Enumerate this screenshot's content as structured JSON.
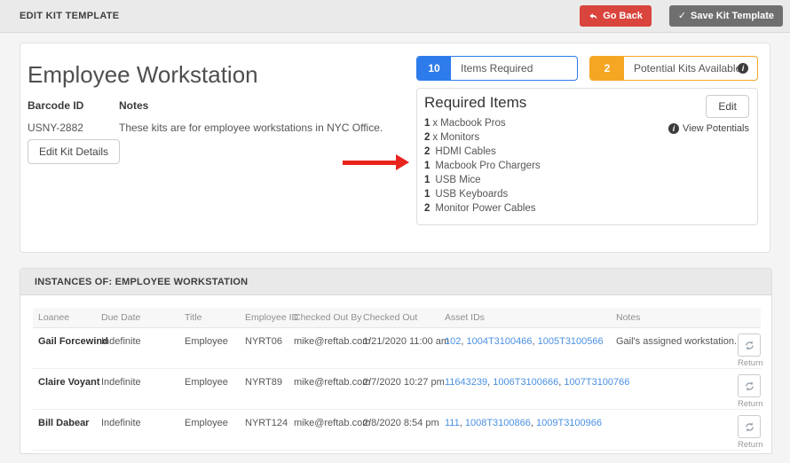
{
  "colors": {
    "accent_blue": "#2e7bec",
    "accent_orange": "#f5a623",
    "danger_red": "#d9443d",
    "button_gray": "#6f6f6f",
    "link_blue": "#4a90e2",
    "arrow_red": "#e8241d"
  },
  "header": {
    "title": "EDIT KIT TEMPLATE",
    "go_back_label": "Go Back",
    "save_label": "Save Kit Template"
  },
  "kit": {
    "title": "Employee Workstation",
    "barcode_label": "Barcode ID",
    "barcode_value": "USNY-2882",
    "notes_label": "Notes",
    "notes_value": "These kits are for employee workstations in NYC Office.",
    "edit_details_label": "Edit Kit Details"
  },
  "badges": {
    "items_required": {
      "count": "10",
      "label": "Items Required"
    },
    "potential_kits": {
      "count": "2",
      "label": "Potential Kits Available"
    }
  },
  "required_items": {
    "title": "Required Items",
    "edit_label": "Edit",
    "view_potentials_label": "View Potentials",
    "items": [
      {
        "qty": "1",
        "sep": "x",
        "name": "Macbook Pros"
      },
      {
        "qty": "2",
        "sep": "x",
        "name": "Monitors"
      },
      {
        "qty": "2",
        "sep": "",
        "name": "HDMI Cables"
      },
      {
        "qty": "1",
        "sep": "",
        "name": "Macbook Pro Chargers"
      },
      {
        "qty": "1",
        "sep": "",
        "name": "USB Mice"
      },
      {
        "qty": "1",
        "sep": "",
        "name": "USB Keyboards"
      },
      {
        "qty": "2",
        "sep": "",
        "name": "Monitor Power Cables"
      }
    ]
  },
  "instances": {
    "title": "INSTANCES OF: EMPLOYEE WORKSTATION",
    "columns": [
      "Loanee",
      "Due Date",
      "Title",
      "Employee ID",
      "Checked Out By",
      "Checked Out",
      "Asset IDs",
      "Notes",
      ""
    ],
    "return_label": "Return",
    "rows": [
      {
        "loanee": "Gail Forcewind",
        "due": "Indefinite",
        "title": "Employee",
        "emp_id": "NYRT06",
        "checked_by": "mike@reftab.com",
        "checked_out": "1/21/2020 11:00 am",
        "assets": [
          "102",
          "1004T3100466",
          "1005T3100566"
        ],
        "notes": "Gail's assigned workstation."
      },
      {
        "loanee": "Claire Voyant",
        "due": "Indefinite",
        "title": "Employee",
        "emp_id": "NYRT89",
        "checked_by": "mike@reftab.com",
        "checked_out": "2/7/2020 10:27 pm",
        "assets": [
          "11643239",
          "1006T3100666",
          "1007T3100766"
        ],
        "notes": ""
      },
      {
        "loanee": "Bill Dabear",
        "due": "Indefinite",
        "title": "Employee",
        "emp_id": "NYRT124",
        "checked_by": "mike@reftab.com",
        "checked_out": "2/8/2020 8:54 pm",
        "assets": [
          "111",
          "1008T3100866",
          "1009T3100966"
        ],
        "notes": ""
      }
    ]
  }
}
